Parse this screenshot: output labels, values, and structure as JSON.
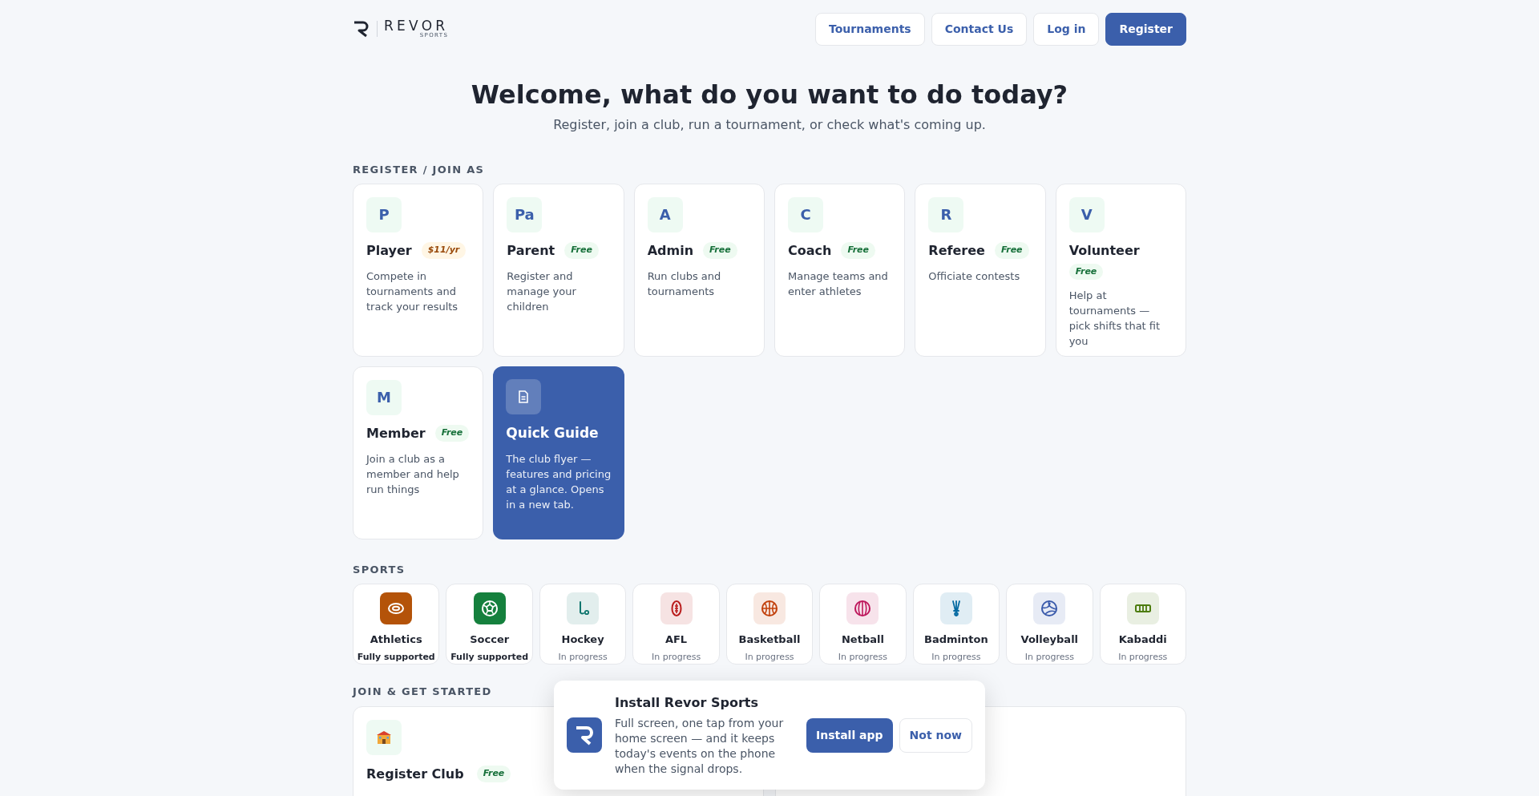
{
  "logo": {
    "wordmark": "REVOR",
    "tagline": "SPORTS"
  },
  "nav": [
    {
      "label": "Tournaments",
      "primary": false
    },
    {
      "label": "Contact Us",
      "primary": false
    },
    {
      "label": "Log in",
      "primary": false
    },
    {
      "label": "Register",
      "primary": true
    }
  ],
  "heading": "Welcome, what do you want to do today?",
  "subheading": "Register, join a club, run a tournament, or check what's coming up.",
  "roles_section": {
    "title": "REGISTER / JOIN AS",
    "cards": [
      {
        "kind": "role",
        "initials": "P",
        "title": "Player",
        "badge": "$11/yr",
        "paid": true,
        "description": "Compete in tournaments and track your results"
      },
      {
        "kind": "role",
        "initials": "Pa",
        "title": "Parent",
        "badge": "Free",
        "paid": false,
        "description": "Register and manage your children"
      },
      {
        "kind": "role",
        "initials": "A",
        "title": "Admin",
        "badge": "Free",
        "paid": false,
        "description": "Run clubs and tournaments"
      },
      {
        "kind": "role",
        "initials": "C",
        "title": "Coach",
        "badge": "Free",
        "paid": false,
        "description": "Manage teams and enter athletes"
      },
      {
        "kind": "role",
        "initials": "R",
        "title": "Referee",
        "badge": "Free",
        "paid": false,
        "description": "Officiate contests"
      },
      {
        "kind": "role",
        "initials": "V",
        "title": "Volunteer",
        "badge": "Free",
        "paid": false,
        "description": "Help at tournaments — pick shifts that fit you"
      },
      {
        "kind": "role",
        "initials": "M",
        "title": "Member",
        "badge": "Free",
        "paid": false,
        "description": "Join a club as a member and help run things"
      },
      {
        "kind": "guide",
        "title": "Quick Guide",
        "description": "The club flyer — features and pricing at a glance. Opens in a new tab."
      }
    ]
  },
  "sports_section": {
    "title": "SPORTS",
    "sports": [
      {
        "name": "Athletics",
        "status": "Fully supported",
        "supported": true,
        "color": "#b45309"
      },
      {
        "name": "Soccer",
        "status": "Fully supported",
        "supported": true,
        "color": "#15803d"
      },
      {
        "name": "Hockey",
        "status": "In progress",
        "supported": false,
        "color": "#0f766e"
      },
      {
        "name": "AFL",
        "status": "In progress",
        "supported": false,
        "color": "#b91c1c"
      },
      {
        "name": "Basketball",
        "status": "In progress",
        "supported": false,
        "color": "#c2410c"
      },
      {
        "name": "Netball",
        "status": "In progress",
        "supported": false,
        "color": "#be185d"
      },
      {
        "name": "Badminton",
        "status": "In progress",
        "supported": false,
        "color": "#0369a1"
      },
      {
        "name": "Volleyball",
        "status": "In progress",
        "supported": false,
        "color": "#3b5bab"
      },
      {
        "name": "Kabaddi",
        "status": "In progress",
        "supported": false,
        "color": "#4d7c0f"
      }
    ]
  },
  "join_section": {
    "title": "JOIN & GET STARTED",
    "cards": [
      {
        "title": "Register Club",
        "badge": "Free",
        "paid": false
      }
    ]
  },
  "install_prompt": {
    "title": "Install Revor Sports",
    "text": "Full screen, one tap from your home screen — and it keeps today's events on the phone when the signal drops.",
    "buttons": [
      {
        "label": "Install app",
        "primary": true
      },
      {
        "label": "Not now",
        "primary": false
      }
    ]
  }
}
